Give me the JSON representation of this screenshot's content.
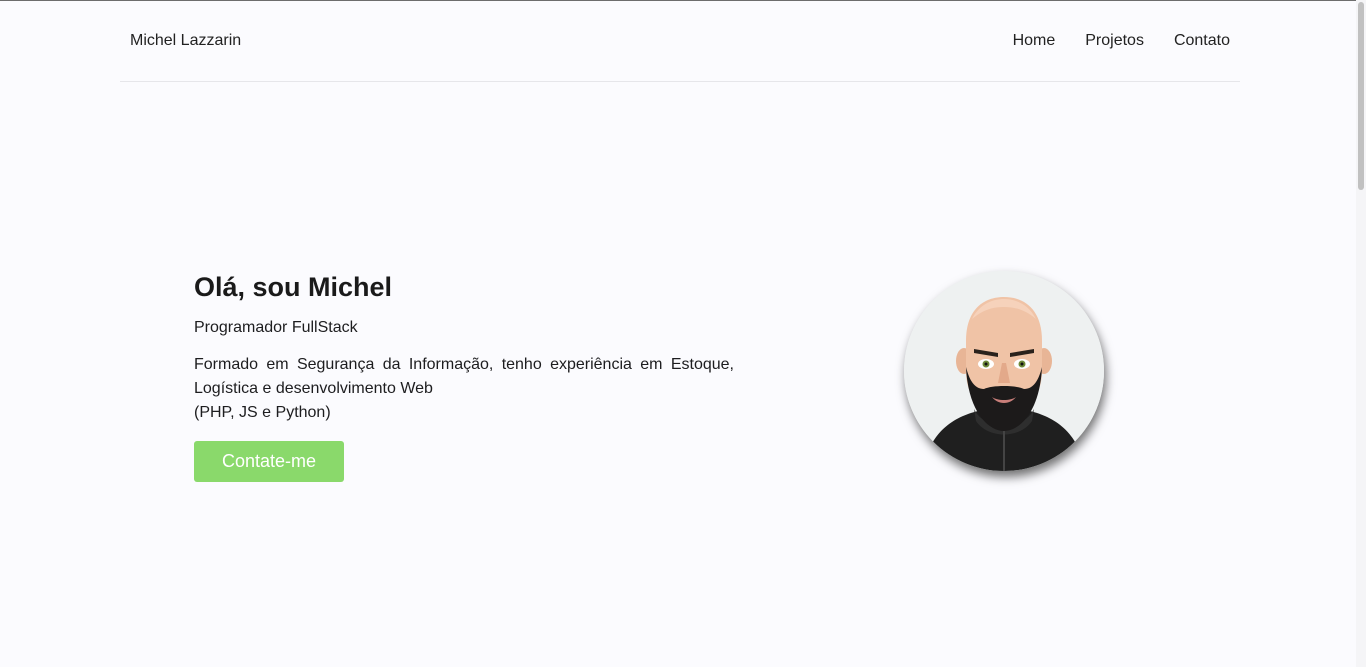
{
  "header": {
    "brand": "Michel Lazzarin",
    "nav": [
      {
        "label": "Home"
      },
      {
        "label": "Projetos"
      },
      {
        "label": "Contato"
      }
    ]
  },
  "hero": {
    "title": "Olá, sou Michel",
    "role": "Programador FullStack",
    "description_line1": "Formado em Segurança da Informação, tenho experiência em Estoque,",
    "description_line2": "Logística e desenvolvimento Web",
    "description_line3": "(PHP, JS e Python)",
    "cta_label": "Contate-me"
  },
  "colors": {
    "background": "#fbfbfe",
    "cta": "#8ad96b",
    "text": "#1d1d1f"
  }
}
